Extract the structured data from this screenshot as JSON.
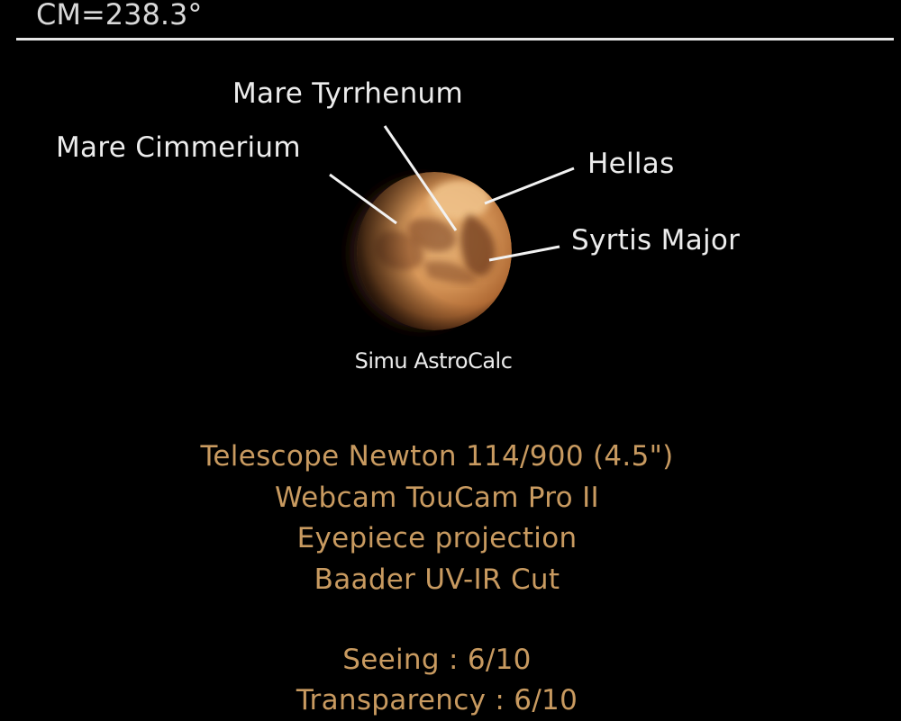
{
  "header": {
    "central_meridian": "CM=238.3°"
  },
  "features": {
    "mare_tyrrhenum": "Mare Tyrrhenum",
    "mare_cimmerium": "Mare Cimmerium",
    "hellas": "Hellas",
    "syrtis_major": "Syrtis Major"
  },
  "credit": "Simu AstroCalc",
  "equipment": [
    "Telescope Newton 114/900 (4.5\")",
    "Webcam TouCam Pro II",
    "Eyepiece projection",
    "Baader UV-IR Cut"
  ],
  "conditions": {
    "seeing": "Seeing : 6/10",
    "transparency": "Transparency : 6/10"
  },
  "colors": {
    "background": "#000000",
    "label_text": "#ececec",
    "info_text": "#c89a60",
    "planet_core": "#e0a86a",
    "planet_edge": "#8a4e26"
  }
}
